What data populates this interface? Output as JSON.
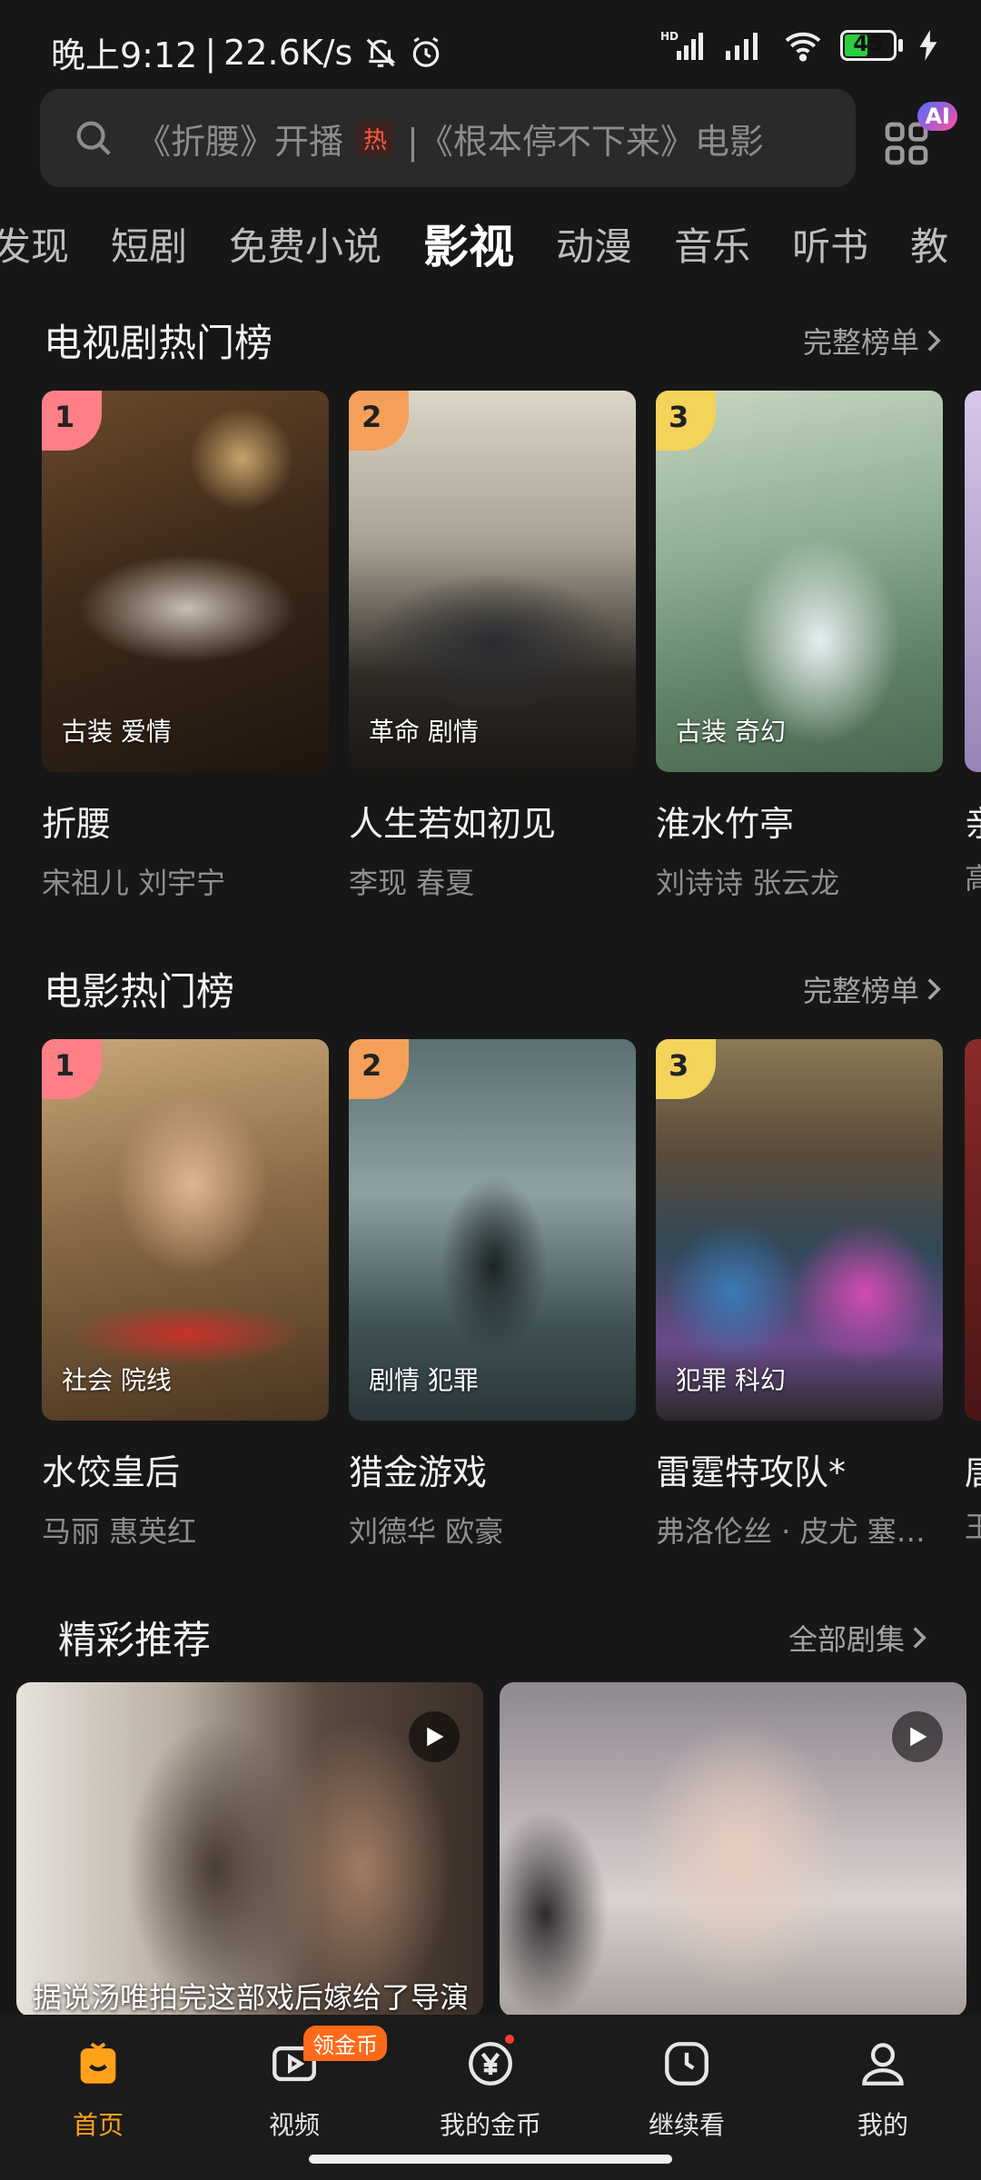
{
  "status_bar": {
    "time": "晚上9:12",
    "speed": "22.6K/s",
    "battery": "45",
    "battery_level": 0.45
  },
  "search": {
    "placeholder_part1": "《折腰》开播",
    "hot_badge": "热",
    "placeholder_part2": "|《根本停不下来》电影",
    "ai_badge": "AI"
  },
  "tabs": [
    "发现",
    "短剧",
    "免费小说",
    "影视",
    "动漫",
    "音乐",
    "听书",
    "教"
  ],
  "tv_section": {
    "title": "电视剧热门榜",
    "more": "完整榜单",
    "items": [
      {
        "rank": "1",
        "tags": "古装 爱情",
        "title": "折腰",
        "cast": "宋祖儿 刘宇宁"
      },
      {
        "rank": "2",
        "tags": "革命 剧情",
        "title": "人生若如初见",
        "cast": "李现 春夏"
      },
      {
        "rank": "3",
        "tags": "古装 奇幻",
        "title": "淮水竹亭",
        "cast": "刘诗诗 张云龙"
      }
    ],
    "peek_title": "亲",
    "peek_cast": "高"
  },
  "movie_section": {
    "title": "电影热门榜",
    "more": "完整榜单",
    "items": [
      {
        "rank": "1",
        "tags": "社会 院线",
        "title": "水饺皇后",
        "cast": "马丽 惠英红"
      },
      {
        "rank": "2",
        "tags": "剧情 犯罪",
        "title": "猎金游戏",
        "cast": "刘德华 欧豪"
      },
      {
        "rank": "3",
        "tags": "犯罪 科幻",
        "title": "雷霆特攻队*",
        "cast": "弗洛伦丝 · 皮尤 塞…"
      }
    ],
    "peek_title": "唐",
    "peek_cast": "王"
  },
  "rec_section": {
    "title": "精彩推荐",
    "more": "全部剧集",
    "items": [
      {
        "caption": "据说汤唯拍完这部戏后嫁给了导演"
      },
      {
        "caption": ""
      }
    ]
  },
  "bottom_nav": {
    "items": [
      "首页",
      "视频",
      "我的金币",
      "继续看",
      "我的"
    ],
    "coin_badge": "领金币"
  },
  "colors": {
    "accent": "#ffa11a",
    "rank1": "#ff7f86",
    "rank2": "#f5a05a",
    "rank3": "#f3d35a"
  }
}
